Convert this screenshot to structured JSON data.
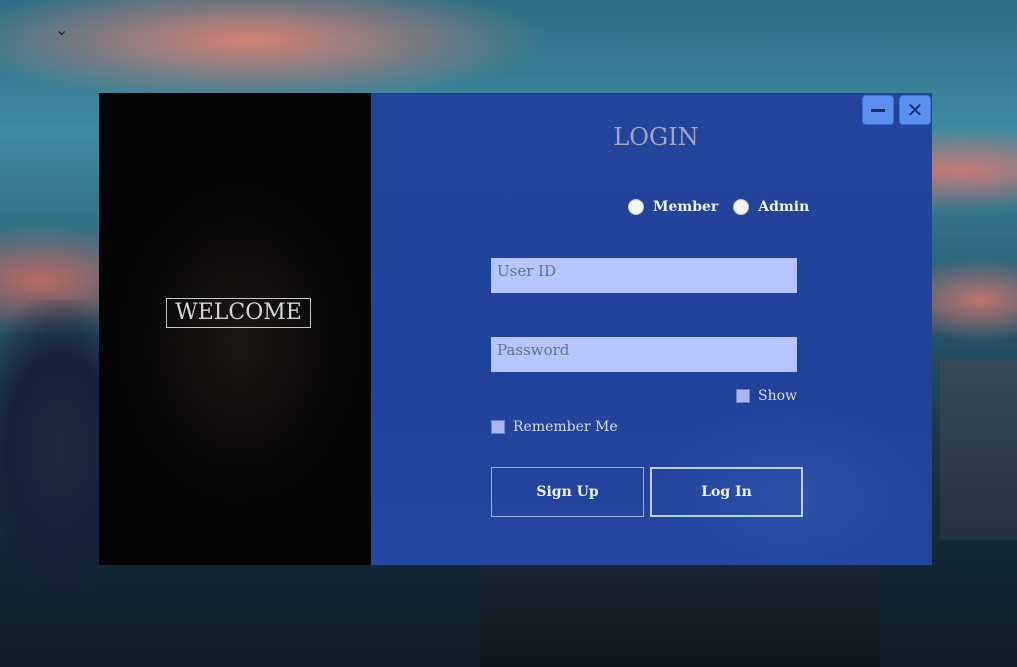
{
  "left_panel": {
    "welcome_text": "WELCOME"
  },
  "window_controls": {
    "minimize_icon": "minus-icon",
    "close_icon": "close-icon",
    "close_glyph": "✕"
  },
  "login": {
    "title": "LOGIN",
    "role_options": [
      "Member",
      "Admin"
    ],
    "user_id_placeholder": "User ID",
    "password_placeholder": "Password",
    "show_label": "Show",
    "remember_label": "Remember Me",
    "signup_label": "Sign Up",
    "login_label": "Log In"
  },
  "colors": {
    "panel_bg": "#22449a",
    "input_bg": "#b6c4ff",
    "window_button": "#5b8ff0"
  }
}
